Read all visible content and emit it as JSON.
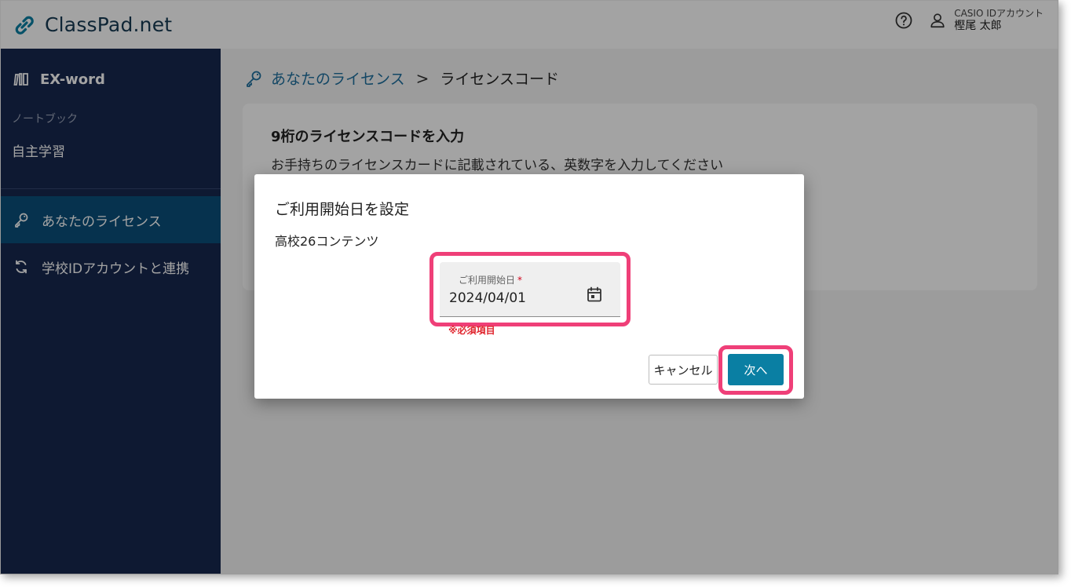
{
  "header": {
    "logo_text": "ClassPad.net",
    "account_label": "CASIO IDアカウント",
    "account_name": "樫尾 太郎"
  },
  "sidebar": {
    "app_title": "EX-word",
    "section_label": "ノートブック",
    "self_study": "自主学習",
    "items": [
      {
        "label": "あなたのライセンス",
        "icon": "key-icon",
        "active": true
      },
      {
        "label": "学校IDアカウントと連携",
        "icon": "sync-icon",
        "active": false
      }
    ]
  },
  "breadcrumb": {
    "parent": "あなたのライセンス",
    "separator": ">",
    "current": "ライセンスコード"
  },
  "card": {
    "title": "9桁のライセンスコードを入力",
    "subtitle": "お手持ちのライセンスカードに記載されている、英数字を入力してください"
  },
  "dialog": {
    "title": "ご利用開始日を設定",
    "content_name": "高校26コンテンツ",
    "date_field": {
      "label": "ご利用開始日",
      "required_mark": "*",
      "value": "2024/04/01",
      "error": "※必須項目"
    },
    "cancel_label": "キャンセル",
    "next_label": "次へ"
  },
  "colors": {
    "sidebar_bg": "#17284f",
    "sidebar_active": "#0a4f7a",
    "primary_button": "#0a7fa3",
    "highlight": "#ef3f78",
    "link": "#1e6f9e"
  }
}
